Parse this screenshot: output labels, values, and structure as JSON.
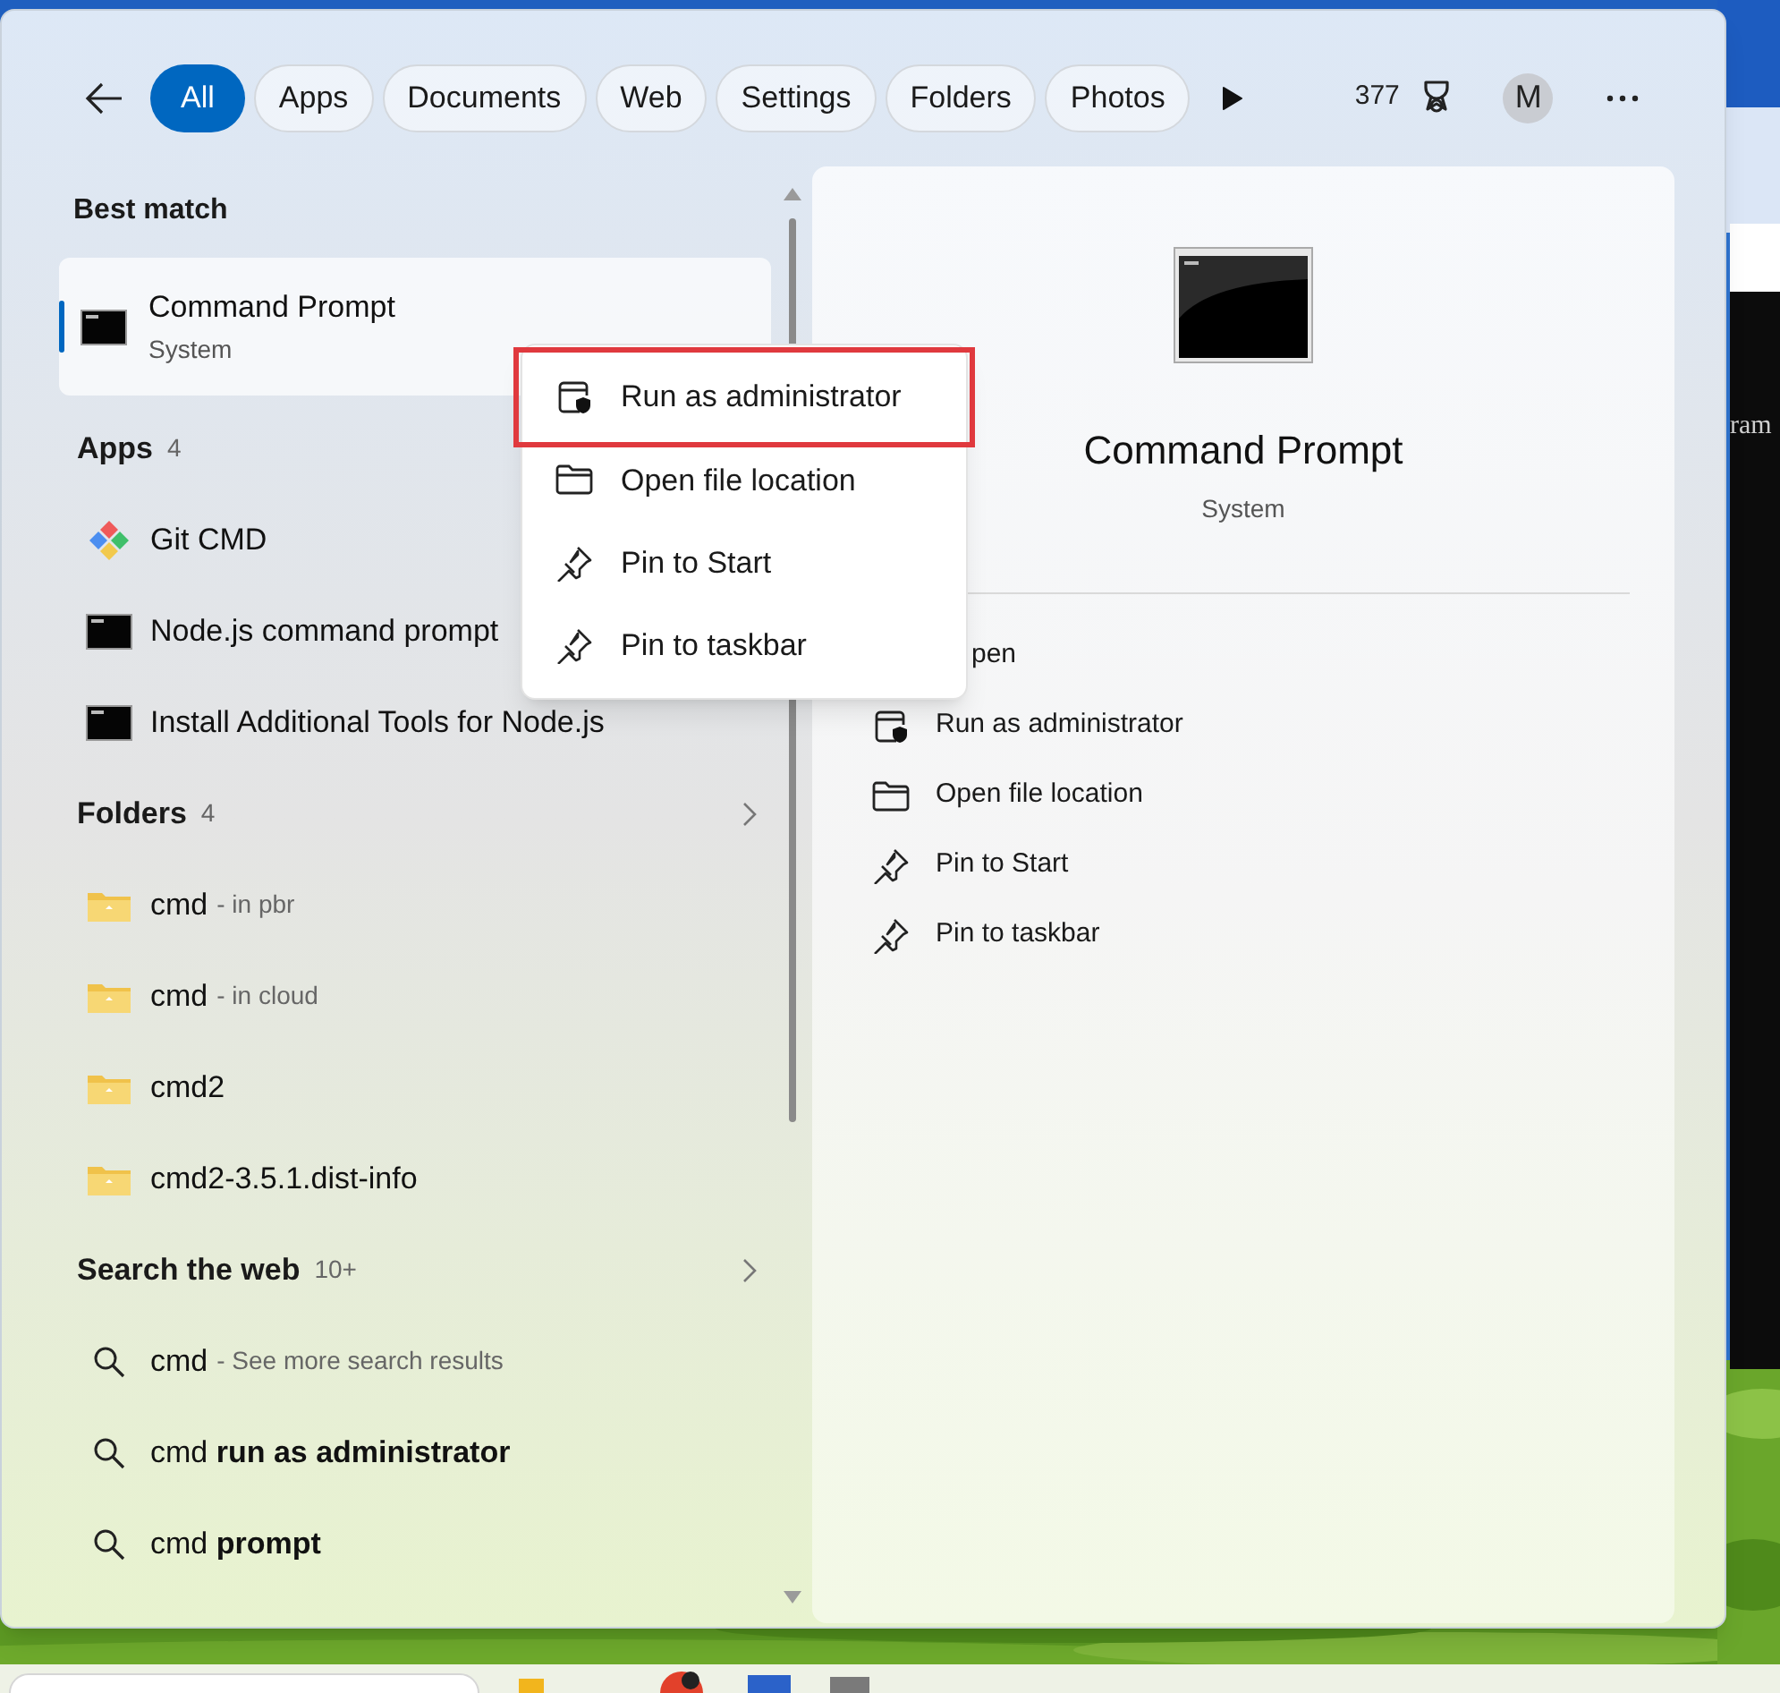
{
  "filters": {
    "tabs": [
      {
        "label": "All",
        "selected": true
      },
      {
        "label": "Apps",
        "selected": false
      },
      {
        "label": "Documents",
        "selected": false
      },
      {
        "label": "Web",
        "selected": false
      },
      {
        "label": "Settings",
        "selected": false
      },
      {
        "label": "Folders",
        "selected": false
      },
      {
        "label": "Photos",
        "selected": false
      }
    ],
    "points": "377",
    "avatar": "M"
  },
  "best_match": {
    "title": "Best match",
    "item": {
      "kind": "cmd",
      "name": "Command Prompt",
      "subtitle": "System",
      "selected": true
    }
  },
  "sections": [
    {
      "title": "Apps",
      "count": "4",
      "more": false,
      "items": [
        {
          "kind": "git",
          "name": "Git CMD"
        },
        {
          "kind": "cmd",
          "name": "Node.js command prompt"
        },
        {
          "kind": "cmd",
          "name": "Install Additional Tools for Node.js"
        }
      ]
    },
    {
      "title": "Folders",
      "count": "4",
      "more": true,
      "items": [
        {
          "kind": "folder",
          "name": "cmd",
          "detail": "- in pbr"
        },
        {
          "kind": "folder",
          "name": "cmd",
          "detail": "- in cloud"
        },
        {
          "kind": "folder",
          "name": "cmd2"
        },
        {
          "kind": "folder",
          "name": "cmd2-3.5.1.dist-info"
        }
      ]
    },
    {
      "title": "Search the web",
      "count": "10+",
      "more": true,
      "items": [
        {
          "kind": "search",
          "name": "cmd",
          "detail": "- See more search results"
        },
        {
          "kind": "search",
          "name": "cmd **run as administrator**"
        },
        {
          "kind": "search",
          "name": "cmd **prompt**"
        }
      ]
    }
  ],
  "details": {
    "name": "Command Prompt",
    "subtitle": "System",
    "actions": [
      {
        "kind": "covered",
        "label": "pen"
      },
      {
        "kind": "shield",
        "label": "Run as administrator"
      },
      {
        "kind": "folder-outline",
        "label": "Open file location"
      },
      {
        "kind": "pin",
        "label": "Pin to Start"
      },
      {
        "kind": "pin",
        "label": "Pin to taskbar"
      }
    ]
  },
  "context_menu": {
    "items": [
      {
        "kind": "shield",
        "label": "Run as administrator",
        "highlighted": true
      },
      {
        "kind": "folder-outline",
        "label": "Open file location",
        "highlighted": false
      },
      {
        "kind": "pin",
        "label": "Pin to Start",
        "highlighted": false
      },
      {
        "kind": "pin",
        "label": "Pin to taskbar",
        "highlighted": false
      }
    ]
  },
  "background_window": {
    "text": "ram"
  }
}
